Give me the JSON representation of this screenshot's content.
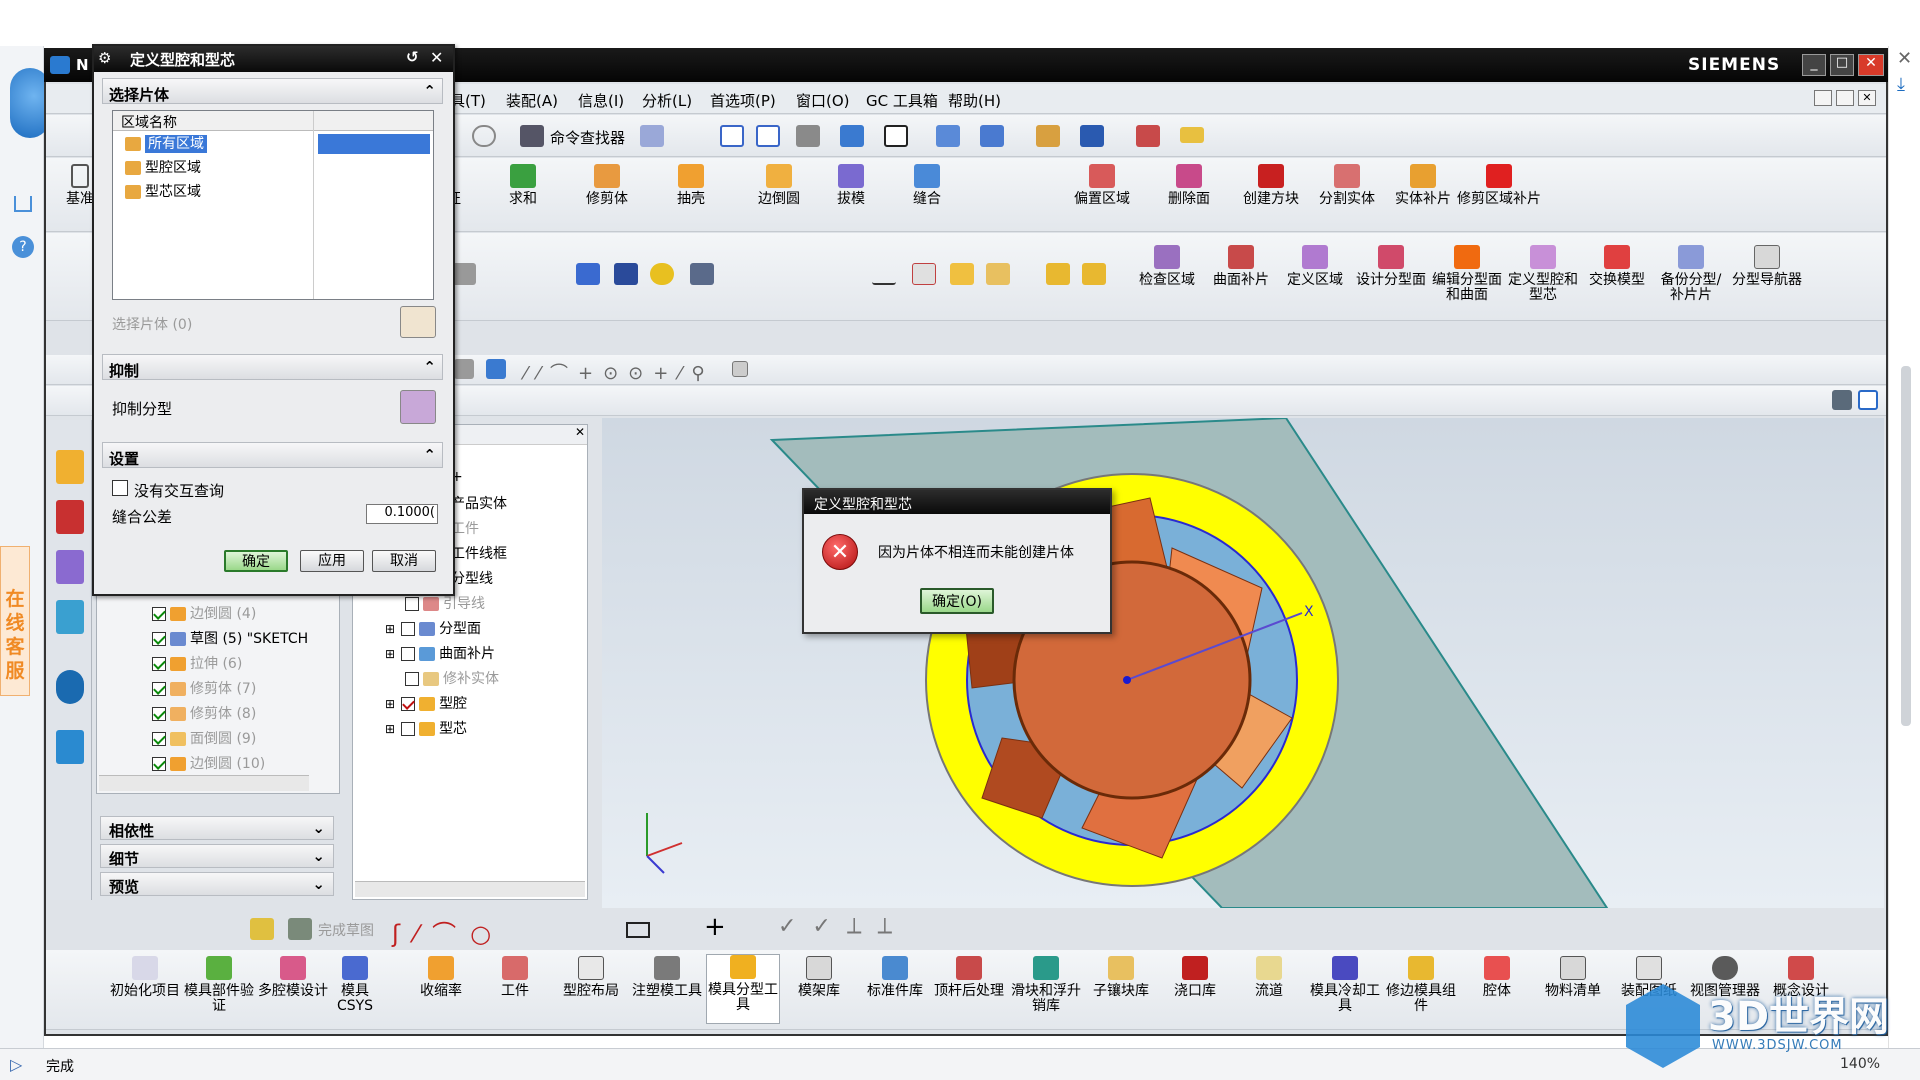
{
  "app": {
    "title_short": "N",
    "brand": "SIEMENS"
  },
  "menu": {
    "items": [
      "具(T)",
      "装配(A)",
      "信息(I)",
      "分析(L)",
      "首选项(P)",
      "窗口(O)",
      "GC 工具箱",
      "帮助(H)"
    ]
  },
  "toolbar1": {
    "find_command": "命令查找器"
  },
  "ribbon_left": {
    "items": [
      "基准",
      "征",
      "求和",
      "修剪体",
      "抽壳",
      "边倒圆",
      "拔模",
      "缝合",
      "偏置区域",
      "删除面",
      "创建方块",
      "分割实体",
      "实体补片",
      "修剪区域补片"
    ]
  },
  "ribbon_right": {
    "items": [
      "检查区域",
      "曲面补片",
      "定义区域",
      "设计分型面",
      "编辑分型面和曲面",
      "定义型腔和型芯",
      "交换模型",
      "备份分型/补片片",
      "分型导航器"
    ]
  },
  "main_dialog": {
    "title": "定义型腔和型芯",
    "section_select": "选择片体",
    "list_header": "区域名称",
    "regions": [
      "所有区域",
      "型腔区域",
      "型芯区域"
    ],
    "select_sheet": "选择片体 (0)",
    "section_suppress": "抑制",
    "suppress_parting": "抑制分型",
    "section_settings": "设置",
    "no_interaction_query": "没有交互查询",
    "stitch_tolerance_label": "缝合公差",
    "stitch_tolerance_value": "0.1000(",
    "ok": "确定",
    "apply": "应用",
    "cancel": "取消"
  },
  "part_tree": {
    "rows": [
      {
        "label": "边倒圆 (4)",
        "checked": true,
        "dim": true
      },
      {
        "label": "草图 (5) \"SKETCH",
        "checked": true,
        "dim": false
      },
      {
        "label": "拉伸 (6)",
        "checked": true,
        "dim": true
      },
      {
        "label": "修剪体 (7)",
        "checked": true,
        "dim": true
      },
      {
        "label": "修剪体 (8)",
        "checked": true,
        "dim": true
      },
      {
        "label": "面倒圆 (9)",
        "checked": true,
        "dim": true
      },
      {
        "label": "边倒圆 (10)",
        "checked": true,
        "dim": true
      }
    ],
    "panels": [
      "相依性",
      "细节",
      "预览"
    ]
  },
  "parting_nav": {
    "rows": [
      {
        "label": "+",
        "dim": false
      },
      {
        "label": "产品实体",
        "dim": false
      },
      {
        "label": "工件",
        "dim": true
      },
      {
        "label": "工件线框",
        "dim": false
      },
      {
        "label": "分型线",
        "dim": false
      },
      {
        "label": "引导线",
        "dim": true,
        "box": true
      },
      {
        "label": "分型面",
        "dim": false,
        "box": true,
        "expand": true
      },
      {
        "label": "曲面补片",
        "dim": false,
        "box": true,
        "expand": true
      },
      {
        "label": "修补实体",
        "dim": true,
        "box": true
      },
      {
        "label": "型腔",
        "dim": false,
        "box": true,
        "expand": true,
        "checked": true
      },
      {
        "label": "型芯",
        "dim": false,
        "box": true,
        "expand": true
      }
    ]
  },
  "error_dialog": {
    "title": "定义型腔和型芯",
    "message": "因为片体不相连而未能创建片体",
    "ok": "确定(O)"
  },
  "sketch_bar": {
    "finish_sketch": "完成草图"
  },
  "bottom_toolbar": {
    "items": [
      "初始化项目",
      "模具部件验证",
      "多腔模设计",
      "模具CSYS",
      "收缩率",
      "工件",
      "型腔布局",
      "注塑模工具",
      "模具分型工具",
      "模架库",
      "标准件库",
      "顶杆后处理",
      "滑块和浮升销库",
      "子镶块库",
      "浇口库",
      "流道",
      "模具冷却工具",
      "修边模具组件",
      "腔体",
      "物料清单",
      "装配图纸",
      "视图管理器",
      "概念设计"
    ]
  },
  "side_service": {
    "text": "在线客服"
  },
  "status": {
    "text": "完成",
    "zoom": "140%"
  },
  "watermark": {
    "logo": "3D世界网",
    "url": "WWW.3DSJW.COM"
  },
  "colors": {
    "title_bg": "#0a0a0a",
    "viewport_plate": "#a3bcbc",
    "ring": "#ffff00",
    "part": "#d2693a",
    "error_icon": "#d42020",
    "service_orange": "#f08a24"
  }
}
